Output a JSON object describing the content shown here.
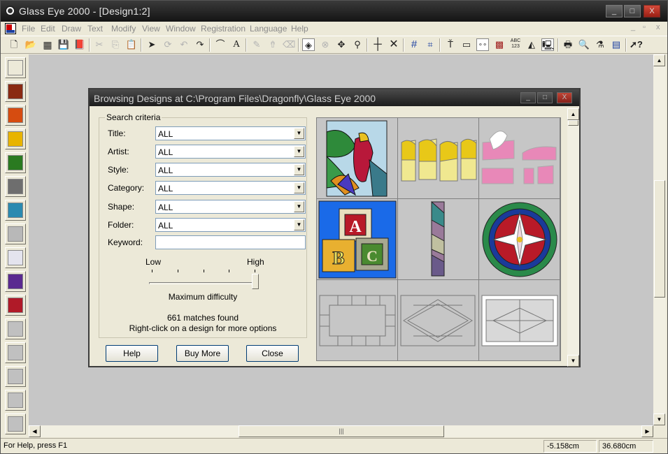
{
  "window": {
    "title": "Glass Eye 2000 - [Design1:2]",
    "controls": {
      "minimize": "_",
      "maximize": "□",
      "close": "X"
    }
  },
  "menubar": {
    "items": [
      "File",
      "Edit",
      "Draw",
      "Text",
      "Modify",
      "View",
      "Window",
      "Registration",
      "Language",
      "Help"
    ],
    "mdi_controls": {
      "minimize": "_",
      "restore": "▫",
      "close": "x"
    }
  },
  "toolbar": {
    "buttons": [
      "new-icon",
      "open-icon",
      "grid-pattern-icon",
      "save-icon",
      "library-icon",
      "cut-icon",
      "copy-icon",
      "paste-icon",
      "select-arrow-icon",
      "lasso-icon",
      "undo-icon",
      "redo-icon",
      "curve-tool-icon",
      "text-tool-icon",
      "pencil-icon",
      "fill-icon",
      "eraser-icon",
      "paint-bucket-icon",
      "no-icon",
      "move-icon",
      "zoom-icon",
      "line-icon",
      "cross-icon",
      "grid-icon",
      "snap-icon",
      "text-cursor-icon",
      "ruler-icon",
      "nodes-icon",
      "pattern-icon",
      "abc-123-icon",
      "layers-icon",
      "monitor-icon",
      "print-icon",
      "preview-icon",
      "estimate-icon",
      "price-icon",
      "help-cursor-icon"
    ],
    "abc_label": "ABC 123"
  },
  "palette": {
    "colors": [
      "#ece9d8",
      "#8a2a12",
      "#d64c10",
      "#e8b400",
      "#2a7a20",
      "#6e6e6e",
      "#2a8ab0",
      "#b8b8b8",
      "#e4e4ee",
      "#5a2a90",
      "#b01a28",
      "#c0c0c0",
      "#c0c0c0",
      "#c0c0c0",
      "#c0c0c0",
      "#c0c0c0"
    ]
  },
  "dialog": {
    "title": "Browsing Designs at C:\\Program Files\\Dragonfly\\Glass Eye 2000",
    "controls": {
      "minimize": "_",
      "maximize": "□",
      "close": "X"
    },
    "search_criteria_label": "Search criteria",
    "fields": [
      {
        "label": "Title:",
        "value": "ALL"
      },
      {
        "label": "Artist:",
        "value": "ALL"
      },
      {
        "label": "Style:",
        "value": "ALL"
      },
      {
        "label": "Category:",
        "value": "ALL"
      },
      {
        "label": "Shape:",
        "value": "ALL"
      },
      {
        "label": "Folder:",
        "value": "ALL"
      }
    ],
    "keyword": {
      "label": "Keyword:",
      "value": ""
    },
    "difficulty": {
      "low_label": "Low",
      "high_label": "High",
      "caption": "Maximum difficulty",
      "level": 1.0
    },
    "matches": "661 matches found",
    "hint": "Right-click on a design for more options",
    "buttons": {
      "help": "Help",
      "buy_more": "Buy More",
      "close": "Close"
    },
    "thumbnails": [
      "parrot",
      "tulip-panels",
      "dove-pieces",
      "abc-blocks",
      "narrow-panel",
      "lily-circle",
      "border-frame",
      "diamond-frame",
      "cross-frame"
    ]
  },
  "statusbar": {
    "help_text": "For Help, press F1",
    "x_coord": "-5.158cm",
    "y_coord": "36.680cm"
  }
}
